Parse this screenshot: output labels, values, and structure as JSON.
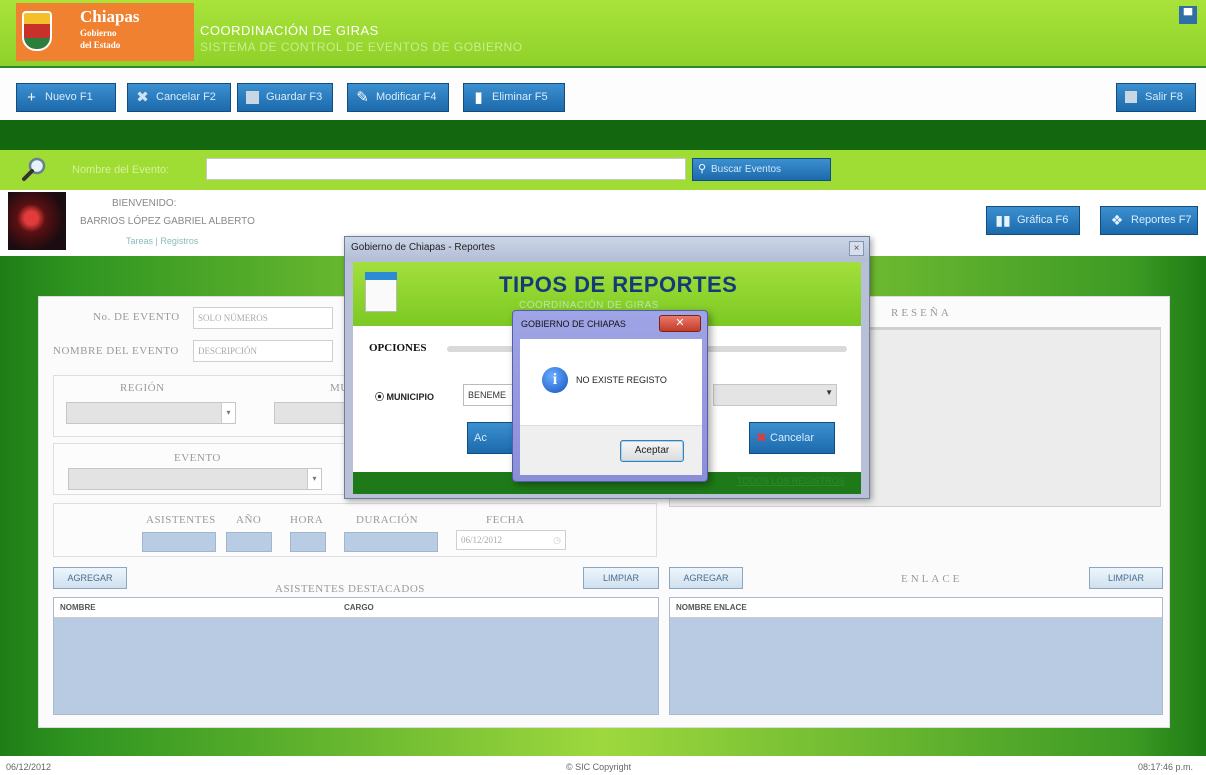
{
  "header": {
    "logo": {
      "title": "Chiapas",
      "subtitle1": "Gobierno",
      "subtitle2": "del Estado"
    },
    "app_title": "COORDINACIÓN DE GIRAS",
    "app_subtitle": "SISTEMA DE CONTROL DE EVENTOS DE GOBIERNO",
    "minimize_icon": "minimize-icon"
  },
  "toolbar": {
    "buttons": [
      {
        "label": "Nuevo F1",
        "icon": "plus-icon"
      },
      {
        "label": "Cancelar F2",
        "icon": "x-icon"
      },
      {
        "label": "Guardar F3",
        "icon": "save-icon"
      },
      {
        "label": "Modificar F4",
        "icon": "pencil-icon"
      },
      {
        "label": "Eliminar F5",
        "icon": "trash-icon"
      }
    ],
    "exit_label": "Salir F8"
  },
  "search": {
    "label": "Nombre del Evento:",
    "value": "",
    "button_label": "Buscar Eventos"
  },
  "welcome": {
    "greeting": "BIENVENIDO:",
    "user": "BARRIOS LÓPEZ GABRIEL ALBERTO",
    "role": "Tareas | Registros",
    "graphs_label": "Gráfica F6",
    "reports_label": "Reportes F7"
  },
  "form": {
    "event_no_label": "No. DE EVENTO",
    "event_no_placeholder": "SOLO NÚMEROS",
    "event_name_label": "NOMBRE DEL EVENTO",
    "event_name_placeholder": "DESCRIPCIÓN",
    "region_label": "REGIÓN",
    "municipio_label": "MU",
    "evento_label": "EVENTO",
    "asistentes_label": "ASISTENTES",
    "anio_label": "AÑO",
    "hora_label": "HORA",
    "duracion_label": "DURACIÓN",
    "fecha_label": "FECHA",
    "fecha_value": "06/12/2012",
    "resena_label": "RESEÑA"
  },
  "attendees": {
    "add_label": "AGREGAR",
    "title": "ASISTENTES DESTACADOS",
    "clear_label": "LIMPIAR",
    "columns": [
      "NOMBRE",
      "CARGO"
    ]
  },
  "liaison": {
    "add_label": "AGREGAR",
    "title": "ENLACE",
    "clear_label": "LIMPIAR",
    "columns": [
      "NOMBRE ENLACE"
    ]
  },
  "report_dialog": {
    "window_title": "Gobierno de Chiapas - Reportes",
    "title": "TIPOS DE REPORTES",
    "subtitle": "COORDINACIÓN DE GIRAS",
    "options_label": "OPCIONES",
    "municipio_option": "MUNICIPIO",
    "municipio_value": "BENEME",
    "accept_label": "Ac",
    "cancel_label": "Cancelar",
    "footer_link": "TODOS LOS REGISTROS"
  },
  "message_box": {
    "title": "GOBIERNO DE CHIAPAS",
    "message": "NO EXISTE REGISTO",
    "ok_label": "Aceptar"
  },
  "statusbar": {
    "date": "06/12/2012",
    "copyright": "© SIC Copyright",
    "time": "08:17:46 p.m."
  }
}
